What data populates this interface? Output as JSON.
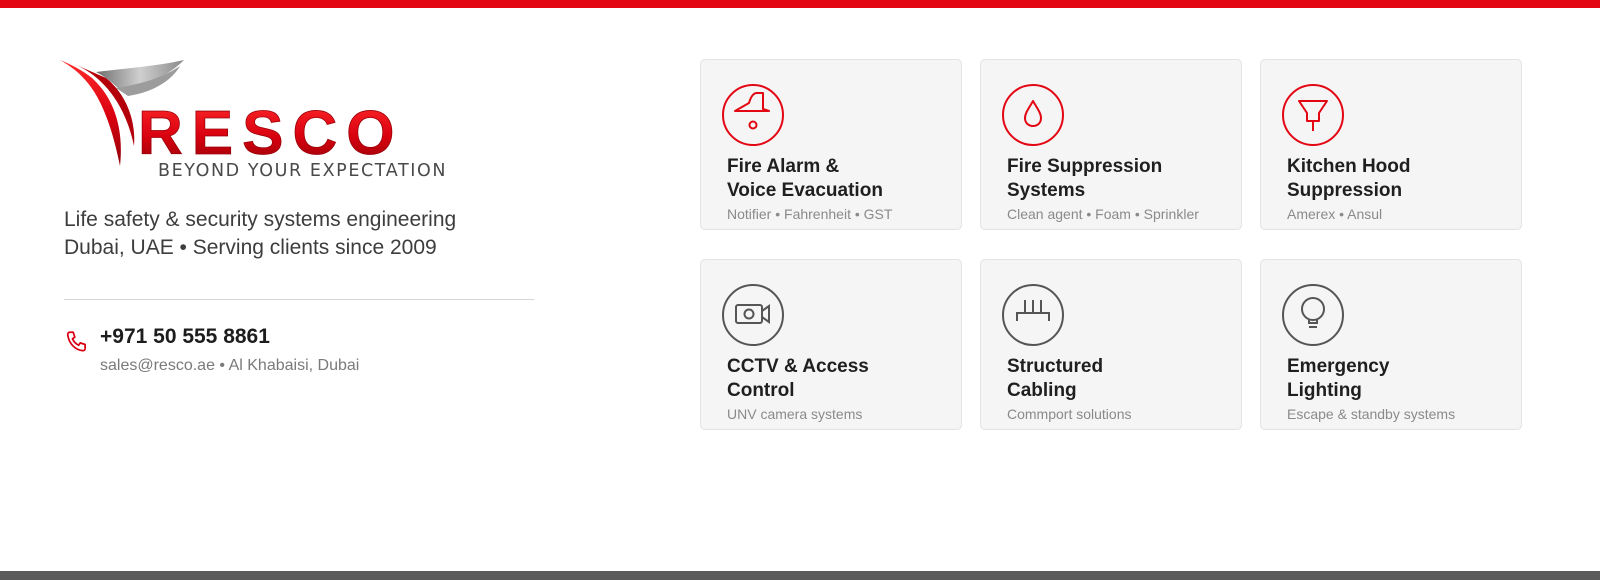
{
  "colors": {
    "accent": "#e30613",
    "footer": "#5b5b5b",
    "card_bg": "#f5f5f5",
    "grey_icon": "#555555"
  },
  "logo": {
    "wordmark": "RESCO",
    "slogan": "BEYOND YOUR EXPECTATION"
  },
  "tagline": {
    "line1": "Life safety & security systems engineering",
    "line2": "Dubai, UAE • Serving clients since 2009"
  },
  "contact": {
    "icon": "phone-icon",
    "phone": "+971 50 555 8861",
    "details": "sales@resco.ae • Al Khabaisi, Dubai"
  },
  "services": [
    {
      "icon": "fire-alarm-icon",
      "icon_color": "#e30613",
      "title_line1": "Fire Alarm &",
      "title_line2": "Voice Evacuation",
      "desc": "Notifier • Fahrenheit • GST"
    },
    {
      "icon": "droplet-icon",
      "icon_color": "#e30613",
      "title_line1": "Fire Suppression",
      "title_line2": "Systems",
      "desc": "Clean agent • Foam • Sprinkler"
    },
    {
      "icon": "kitchen-hood-icon",
      "icon_color": "#e30613",
      "title_line1": "Kitchen Hood",
      "title_line2": "Suppression",
      "desc": "Amerex • Ansul"
    },
    {
      "icon": "camera-icon",
      "icon_color": "#555555",
      "title_line1": "CCTV & Access",
      "title_line2": "Control",
      "desc": "UNV camera systems"
    },
    {
      "icon": "network-cabling-icon",
      "icon_color": "#555555",
      "title_line1": "Structured",
      "title_line2": "Cabling",
      "desc": "Commport solutions"
    },
    {
      "icon": "lightbulb-icon",
      "icon_color": "#555555",
      "title_line1": "Emergency",
      "title_line2": "Lighting",
      "desc": "Escape & standby systems"
    }
  ]
}
